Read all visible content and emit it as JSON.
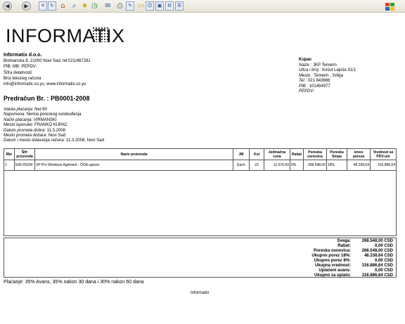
{
  "company": {
    "logo_text": "INFORMATIX",
    "name": "Informatix d.o.o.",
    "address": "Bolmanska 8, 21000 Novi Sad, tel:021/467281",
    "pib_line": "PIB:  MB:   PEPDV:",
    "sifra": "Šifra delatnosti:",
    "racun": "Broj tekućeg računa",
    "contact": "info@informatix.co.yu, www.informatix.co.yu"
  },
  "kupac": {
    "heading": "Kupac",
    "naziv_label": "Naziv :",
    "naziv": "JKP Temerin",
    "ulica_label": "Ulica i broj :",
    "ulica": "Košut Lajoša 31/1",
    "mesto_label": "Mesto :",
    "mesto": "Temerin , Srbija",
    "tel_label": "Tel :",
    "tel": "021 843666",
    "pib_label": "PIB :",
    "pib": "101454977",
    "pepdv_label": "PEPDV:"
  },
  "document": {
    "title": "Predračun   Br. : PB0001-2008"
  },
  "meta": [
    {
      "label": "Valuta plaćanja:",
      "value": "Net 60"
    },
    {
      "label": "Napomena:",
      "value": "Nemia poreskog oslobođenja"
    },
    {
      "label": "Način plaćanja:",
      "value": "VIRMANSKI"
    },
    {
      "label": "Mesto isporuke:",
      "value": "FRANKO KUPAC"
    },
    {
      "label": "Datum prometa dobra:",
      "value": "11.3.2008"
    },
    {
      "label": "Mesto prometa dobara:",
      "value": "Novi Sad"
    },
    {
      "label": "Datum i mesto izdavanja računa:",
      "value": "11.3.2008, Novi Sad"
    }
  ],
  "table": {
    "headers": [
      "Rbr",
      "Šifr proizvoda",
      "Naziv proizvoda",
      "JM",
      "Kol",
      "Jedinačna cena",
      "Rabat",
      "Poreska osnovica",
      "Poreska Stopa",
      "Iznos poreza",
      "Vrednost sa PDV-om"
    ],
    "rows": [
      [
        "1",
        "E65-05204",
        "XP Pro Windows Agriment - OOA ugovor",
        "Each",
        "23",
        "11.676,00",
        "0%",
        "268.548,00",
        "18%",
        "48.338,64",
        "316.886,64"
      ]
    ]
  },
  "totals": [
    {
      "label": "Svega:",
      "value": "268.548,00 CSD"
    },
    {
      "label": "Rabat:",
      "value": "0,00 CSD"
    },
    {
      "label": "Poreska osnovica:",
      "value": "268.548,00 CSD"
    },
    {
      "label": "Ukupno porez 18%:",
      "value": "48.338,64 CSD"
    },
    {
      "label": "Ukupno porez 8%:",
      "value": "0,00 CSD"
    },
    {
      "label": "Ukupna vrednost:",
      "value": "316.886,64 CSD"
    },
    {
      "label": "Uplaćeni avans:",
      "value": "0,00 CSD"
    },
    {
      "label": "Ukupno za uplatu:",
      "value": "316.886,64 CSD"
    }
  ],
  "placanje": "Plaćanje: 35% Avans, 35% nakon 30 dana i 30% nakon 60 dana",
  "footer": "Informatix",
  "icons": [
    "back-icon",
    "forward-icon",
    "stop-icon",
    "refresh-icon",
    "home-icon",
    "search-icon",
    "favorites-icon",
    "history-icon",
    "mail-icon",
    "print-icon",
    "edit-icon",
    "folder-icon",
    "messenger-icon",
    "research-icon",
    "windows-logo-icon"
  ],
  "colors": {
    "toolbar_bg": "#ebe9df",
    "border": "#555555"
  }
}
